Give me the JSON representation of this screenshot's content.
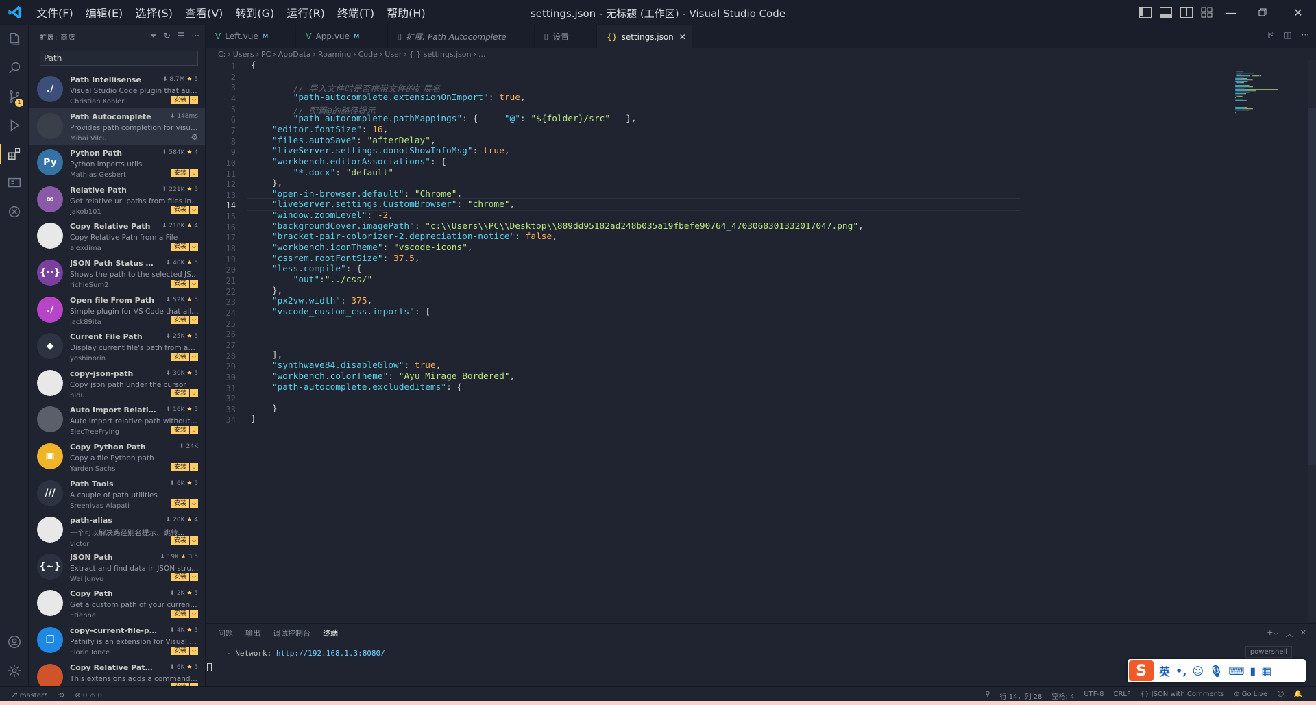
{
  "window": {
    "title": "settings.json - 无标题 (工作区) - Visual Studio Code"
  },
  "menu": [
    "文件(F)",
    "编辑(E)",
    "选择(S)",
    "查看(V)",
    "转到(G)",
    "运行(R)",
    "终端(T)",
    "帮助(H)"
  ],
  "sidebar": {
    "title": "扩展: 商店",
    "search": "Path"
  },
  "extensions": [
    {
      "name": "Path Intellisense",
      "desc": "Visual Studio Code plugin that auto...",
      "pub": "Christian Kohler",
      "stats": "8.7M",
      "rating": "5",
      "installed": false,
      "icon": "./",
      "color": "#3b4f7a"
    },
    {
      "name": "Path Autocomplete",
      "desc": "Provides path completion for visual ...",
      "pub": "Mihai Vilcu",
      "stats": "148ms",
      "rating": "",
      "installed": true,
      "icon": "",
      "color": "#3a3f4a"
    },
    {
      "name": "Python Path",
      "desc": "Python imports utils.",
      "pub": "Mathias Gesbert",
      "stats": "584K",
      "rating": "4",
      "installed": false,
      "icon": "Py",
      "color": "#3572a5"
    },
    {
      "name": "Relative Path",
      "desc": "Get relative url paths from files in th...",
      "pub": "jakob101",
      "stats": "221K",
      "rating": "5",
      "installed": false,
      "icon": "∞",
      "color": "#8a5aa8"
    },
    {
      "name": "Copy Relative Path",
      "desc": "Copy Relative Path from a File",
      "pub": "alexdima",
      "stats": "218K",
      "rating": "4",
      "installed": false,
      "icon": "",
      "color": "#e8e8e8"
    },
    {
      "name": "JSON Path Status Bar",
      "desc": "Shows the path to the selected JSO...",
      "pub": "richieSum2",
      "stats": "40K",
      "rating": "5",
      "installed": false,
      "icon": "{··}",
      "color": "#7b3fa0"
    },
    {
      "name": "Open file From Path",
      "desc": "Simple plugin for VS Code that allo...",
      "pub": "jack89ita",
      "stats": "52K",
      "rating": "5",
      "installed": false,
      "icon": "./",
      "color": "#b845c8"
    },
    {
      "name": "Current File Path",
      "desc": "Display current file's path from abs...",
      "pub": "yoshinorin",
      "stats": "25K",
      "rating": "5",
      "installed": false,
      "icon": "◆",
      "color": "#2d3340"
    },
    {
      "name": "copy-json-path",
      "desc": "Copy json path under the cursor",
      "pub": "nidu",
      "stats": "30K",
      "rating": "5",
      "installed": false,
      "icon": "",
      "color": "#e8e8e8"
    },
    {
      "name": "Auto Import Relative ...",
      "desc": "Auto import relative path without ty...",
      "pub": "ElecTreeFrying",
      "stats": "16K",
      "rating": "5",
      "installed": false,
      "icon": "",
      "color": "#5a5f6a"
    },
    {
      "name": "Copy Python Path",
      "desc": "Copy a file Python path",
      "pub": "Yarden Sachs",
      "stats": "24K",
      "rating": "",
      "installed": false,
      "icon": "▣",
      "color": "#f0b428"
    },
    {
      "name": "Path Tools",
      "desc": "A couple of path utilities",
      "pub": "Sreenivas Alapati",
      "stats": "6K",
      "rating": "5",
      "installed": false,
      "icon": "///",
      "color": "#2d3340"
    },
    {
      "name": "path-alias",
      "desc": "一个可以解决路径别名提示、跳转...",
      "pub": "victor",
      "stats": "20K",
      "rating": "4",
      "installed": false,
      "icon": "",
      "color": "#e8e8e8"
    },
    {
      "name": "JSON Path",
      "desc": "Extract and find data in JSON struct...",
      "pub": "Wei Junyu",
      "stats": "19K",
      "rating": "3.5",
      "installed": false,
      "icon": "{~}",
      "color": "#2c3142"
    },
    {
      "name": "Copy Path",
      "desc": "Get a custom path of your current fi...",
      "pub": "Etienne",
      "stats": "2K",
      "rating": "5",
      "installed": false,
      "icon": "",
      "color": "#e8e8e8"
    },
    {
      "name": "copy-current-file-path",
      "desc": "Pathify is an extension for Visual Stu...",
      "pub": "Florin Ionce",
      "stats": "4K",
      "rating": "5",
      "installed": false,
      "icon": "❐",
      "color": "#1e88e5"
    },
    {
      "name": "Copy Relative Path Posix",
      "desc": "This extensions adds a command to...",
      "pub": "",
      "stats": "6K",
      "rating": "5",
      "installed": false,
      "icon": "",
      "color": "#d0542a"
    }
  ],
  "install_label": "安装",
  "tabs": [
    {
      "label": "Left.vue",
      "mod": "M",
      "italic": false,
      "active": false,
      "iconcolor": "#41b883",
      "icon": "V"
    },
    {
      "label": "App.vue",
      "mod": "M",
      "italic": false,
      "active": false,
      "iconcolor": "#41b883",
      "icon": "V"
    },
    {
      "label": "扩展: Path Autocomplete",
      "mod": "",
      "italic": true,
      "active": false,
      "iconcolor": "#8a919e",
      "icon": "▯"
    },
    {
      "label": "设置",
      "mod": "",
      "italic": false,
      "active": false,
      "iconcolor": "#8a919e",
      "icon": "▯"
    },
    {
      "label": "settings.json",
      "mod": "",
      "italic": false,
      "active": true,
      "iconcolor": "#ffcc66",
      "icon": "{}"
    }
  ],
  "breadcrumb": [
    "C:",
    "Users",
    "PC",
    "AppData",
    "Roaming",
    "Code",
    "User",
    "{ } settings.json",
    "..."
  ],
  "code": [
    [
      [
        "{",
        "#cbccc6"
      ]
    ],
    [],
    [
      [
        "        // 导入文件时是否携带文件的扩展名",
        "#5c6773"
      ]
    ],
    [
      [
        "        \"path-autocomplete.extensionOnImport\"",
        "#5ccfe6"
      ],
      [
        ": ",
        "#cbccc6"
      ],
      [
        "true",
        "#ffae57"
      ],
      [
        ",",
        "#cbccc6"
      ]
    ],
    [
      [
        "        // 配置@的路径提示",
        "#5c6773"
      ]
    ],
    [
      [
        "        \"path-autocomplete.pathMappings\"",
        "#5ccfe6"
      ],
      [
        ": {     ",
        "#cbccc6"
      ],
      [
        "\"@\"",
        "#5ccfe6"
      ],
      [
        ": ",
        "#cbccc6"
      ],
      [
        "\"${folder}/src\"",
        "#bae67e"
      ],
      [
        "   },",
        "#cbccc6"
      ]
    ],
    [
      [
        "    \"editor.fontSize\"",
        "#5ccfe6"
      ],
      [
        ": ",
        "#cbccc6"
      ],
      [
        "16",
        "#ffae57"
      ],
      [
        ",",
        "#cbccc6"
      ]
    ],
    [
      [
        "    \"files.autoSave\"",
        "#5ccfe6"
      ],
      [
        ": ",
        "#cbccc6"
      ],
      [
        "\"afterDelay\"",
        "#bae67e"
      ],
      [
        ",",
        "#cbccc6"
      ]
    ],
    [
      [
        "    \"liveServer.settings.donotShowInfoMsg\"",
        "#5ccfe6"
      ],
      [
        ": ",
        "#cbccc6"
      ],
      [
        "true",
        "#ffae57"
      ],
      [
        ",",
        "#cbccc6"
      ]
    ],
    [
      [
        "    \"workbench.editorAssociations\"",
        "#5ccfe6"
      ],
      [
        ": {",
        "#cbccc6"
      ]
    ],
    [
      [
        "        \"*.docx\"",
        "#5ccfe6"
      ],
      [
        ": ",
        "#cbccc6"
      ],
      [
        "\"default\"",
        "#bae67e"
      ]
    ],
    [
      [
        "    },",
        "#cbccc6"
      ]
    ],
    [
      [
        "    \"open-in-browser.default\"",
        "#5ccfe6"
      ],
      [
        ": ",
        "#cbccc6"
      ],
      [
        "\"Chrome\"",
        "#bae67e"
      ],
      [
        ",",
        "#cbccc6"
      ]
    ],
    [
      [
        "    \"liveServer.settings.CustomBrowser\"",
        "#5ccfe6"
      ],
      [
        ": ",
        "#cbccc6"
      ],
      [
        "\"chrome\"",
        "#bae67e"
      ],
      [
        ",",
        "#cbccc6"
      ]
    ],
    [
      [
        "    \"window.zoomLevel\"",
        "#5ccfe6"
      ],
      [
        ": ",
        "#cbccc6"
      ],
      [
        "-2",
        "#ffae57"
      ],
      [
        ",",
        "#cbccc6"
      ]
    ],
    [
      [
        "    \"backgroundCover.imagePath\"",
        "#5ccfe6"
      ],
      [
        ": ",
        "#cbccc6"
      ],
      [
        "\"c:\\\\Users\\\\PC\\\\Desktop\\\\889dd95182ad248b035a19fbefe90764_4703068301332017047.png\"",
        "#bae67e"
      ],
      [
        ",",
        "#cbccc6"
      ]
    ],
    [
      [
        "    \"bracket-pair-colorizer-2.depreciation-notice\"",
        "#5ccfe6"
      ],
      [
        ": ",
        "#cbccc6"
      ],
      [
        "false",
        "#ffae57"
      ],
      [
        ",",
        "#cbccc6"
      ]
    ],
    [
      [
        "    \"workbench.iconTheme\"",
        "#5ccfe6"
      ],
      [
        ": ",
        "#cbccc6"
      ],
      [
        "\"vscode-icons\"",
        "#bae67e"
      ],
      [
        ",",
        "#cbccc6"
      ]
    ],
    [
      [
        "    \"cssrem.rootFontSize\"",
        "#5ccfe6"
      ],
      [
        ": ",
        "#cbccc6"
      ],
      [
        "37.5",
        "#ffae57"
      ],
      [
        ",",
        "#cbccc6"
      ]
    ],
    [
      [
        "    \"less.compile\"",
        "#5ccfe6"
      ],
      [
        ": {",
        "#cbccc6"
      ]
    ],
    [
      [
        "        \"out\"",
        "#5ccfe6"
      ],
      [
        ":",
        "#cbccc6"
      ],
      [
        "\"../css/\"",
        "#bae67e"
      ]
    ],
    [
      [
        "    },",
        "#cbccc6"
      ]
    ],
    [
      [
        "    \"px2vw.width\"",
        "#5ccfe6"
      ],
      [
        ": ",
        "#cbccc6"
      ],
      [
        "375",
        "#ffae57"
      ],
      [
        ",",
        "#cbccc6"
      ]
    ],
    [
      [
        "    \"vscode_custom_css.imports\"",
        "#5ccfe6"
      ],
      [
        ": [",
        "#cbccc6"
      ]
    ],
    [],
    [],
    [],
    [
      [
        "    ],",
        "#cbccc6"
      ]
    ],
    [
      [
        "    \"synthwave84.disableGlow\"",
        "#5ccfe6"
      ],
      [
        ": ",
        "#cbccc6"
      ],
      [
        "true",
        "#ffae57"
      ],
      [
        ",",
        "#cbccc6"
      ]
    ],
    [
      [
        "    \"workbench.colorTheme\"",
        "#5ccfe6"
      ],
      [
        ": ",
        "#cbccc6"
      ],
      [
        "\"Ayu Mirage Bordered\"",
        "#bae67e"
      ],
      [
        ",",
        "#cbccc6"
      ]
    ],
    [
      [
        "    \"path-autocomplete.excludedItems\"",
        "#5ccfe6"
      ],
      [
        ": {",
        "#cbccc6"
      ]
    ],
    [],
    [
      [
        "    }",
        "#cbccc6"
      ]
    ],
    [
      [
        "}",
        "#cbccc6"
      ]
    ]
  ],
  "current_line": 14,
  "panel": {
    "tabs": [
      "问题",
      "输出",
      "调试控制台",
      "终端"
    ],
    "active": 3,
    "terminal_prefix": "  - Network: ",
    "terminal_url": "http://192.168.1.3:8080/",
    "shell": "powershell"
  },
  "ime": {
    "lang": "英"
  },
  "status": {
    "branch": "master*",
    "errors": "0",
    "warnings": "0",
    "position": "行 14，列 28",
    "spaces": "空格: 4",
    "encoding": "UTF-8",
    "eol": "CRLF",
    "language": "JSON with Comments",
    "golive": "Go Live"
  }
}
